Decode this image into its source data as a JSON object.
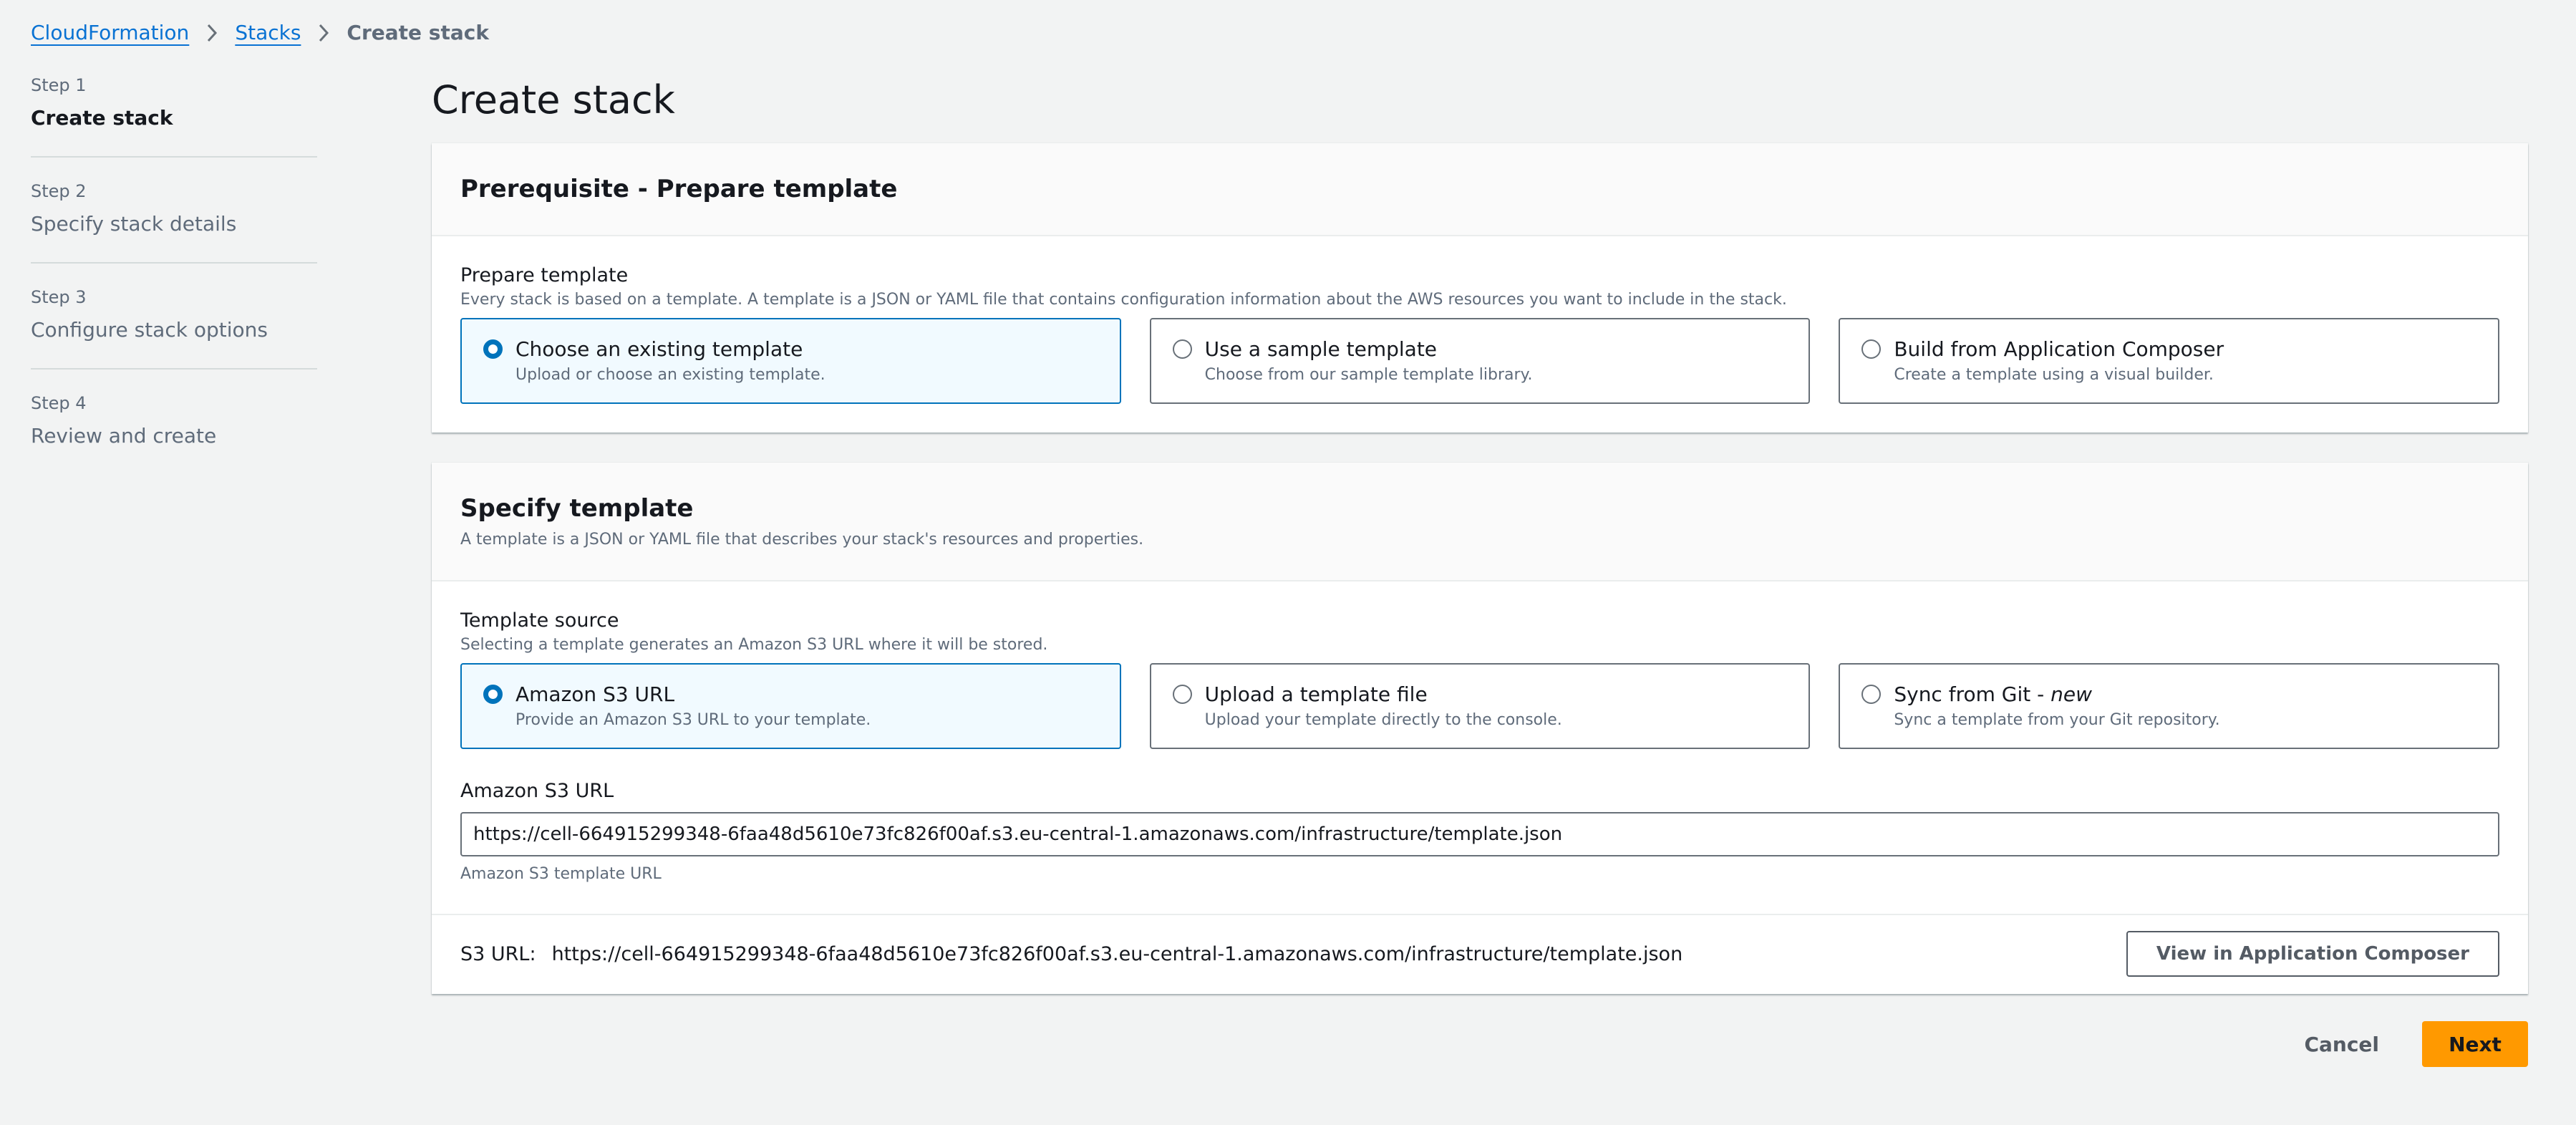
{
  "breadcrumb": {
    "items": [
      {
        "label": "CloudFormation",
        "link": true
      },
      {
        "label": "Stacks",
        "link": true
      },
      {
        "label": "Create stack",
        "link": false
      }
    ],
    "separator_icon": "chevron-right-icon"
  },
  "steps": [
    {
      "number": "Step 1",
      "title": "Create stack",
      "active": true
    },
    {
      "number": "Step 2",
      "title": "Specify stack details",
      "active": false
    },
    {
      "number": "Step 3",
      "title": "Configure stack options",
      "active": false
    },
    {
      "number": "Step 4",
      "title": "Review and create",
      "active": false
    }
  ],
  "page_title": "Create stack",
  "prerequisite": {
    "title": "Prerequisite - Prepare template",
    "field_label": "Prepare template",
    "field_desc": "Every stack is based on a template. A template is a JSON or YAML file that contains configuration information about the AWS resources you want to include in the stack.",
    "options": [
      {
        "title": "Choose an existing template",
        "desc": "Upload or choose an existing template.",
        "selected": true
      },
      {
        "title": "Use a sample template",
        "desc": "Choose from our sample template library.",
        "selected": false
      },
      {
        "title": "Build from Application Composer",
        "desc": "Create a template using a visual builder.",
        "selected": false
      }
    ]
  },
  "specify": {
    "title": "Specify template",
    "desc": "A template is a JSON or YAML file that describes your stack's resources and properties.",
    "source_label": "Template source",
    "source_desc": "Selecting a template generates an Amazon S3 URL where it will be stored.",
    "options": [
      {
        "title": "Amazon S3 URL",
        "title_suffix": "",
        "desc": "Provide an Amazon S3 URL to your template.",
        "selected": true
      },
      {
        "title": "Upload a template file",
        "title_suffix": "",
        "desc": "Upload your template directly to the console.",
        "selected": false
      },
      {
        "title": "Sync from Git - ",
        "title_suffix": "new",
        "desc": "Sync a template from your Git repository.",
        "selected": false
      }
    ],
    "s3_label": "Amazon S3 URL",
    "s3_value": "https://cell-664915299348-6faa48d5610e73fc826f00af.s3.eu-central-1.amazonaws.com/infrastructure/template.json",
    "s3_hint": "Amazon S3 template URL",
    "s3_url_prefix": "S3 URL:",
    "s3_url_display": "https://cell-664915299348-6faa48d5610e73fc826f00af.s3.eu-central-1.amazonaws.com/infrastructure/template.json",
    "view_composer_label": "View in Application Composer"
  },
  "actions": {
    "cancel_label": "Cancel",
    "next_label": "Next"
  },
  "colors": {
    "link": "#0972d3",
    "selected_border": "#0073bb",
    "selected_bg": "#f1faff",
    "primary_button": "#ff9900",
    "page_bg": "#f2f3f3"
  }
}
